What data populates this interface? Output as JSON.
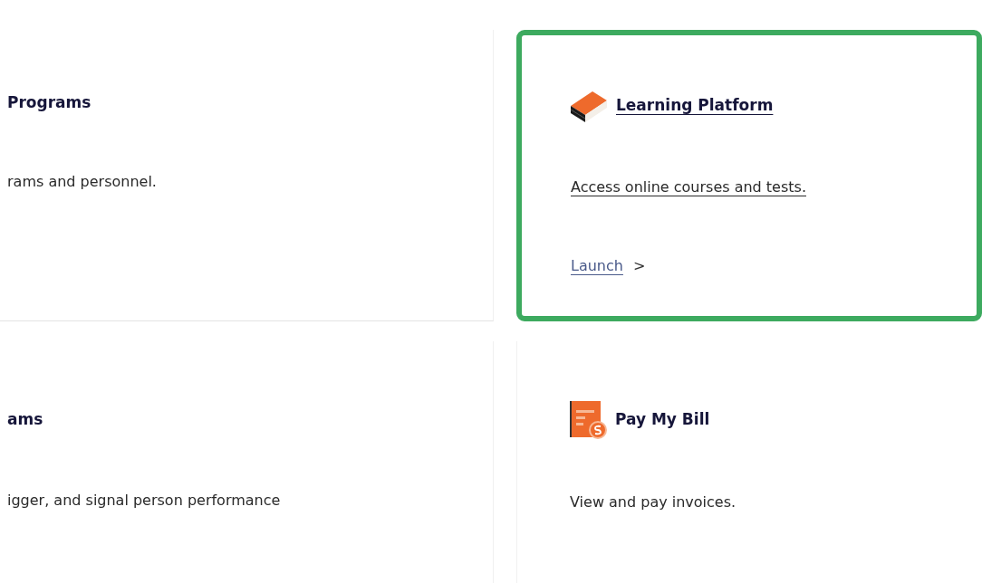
{
  "cards": [
    {
      "title": "Programs",
      "description": "rams and personnel.",
      "highlighted": false
    },
    {
      "title": "Learning Platform",
      "description": "Access online courses and tests.",
      "link": "Launch",
      "link_arrow": ">",
      "kind": "book",
      "highlighted": true
    },
    {
      "title": "ams",
      "description": "igger, and signal person performance",
      "highlighted": false
    },
    {
      "title": "Pay My Bill",
      "description": "View and pay invoices.",
      "kind": "bill",
      "highlighted": false
    }
  ]
}
